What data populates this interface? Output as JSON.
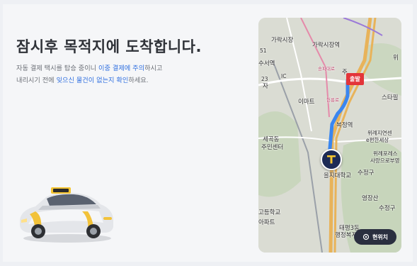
{
  "arrival": {
    "title": "잠시후 목적지에 도착합니다.",
    "line1_pre": "자동 결제 택시를 탑승 중이니 ",
    "line1_hl": "이중 결제에 주의",
    "line1_post": "하시고",
    "line2_pre": "내리시기 전에 ",
    "line2_hl": "잊으신 물건이 없는지 확인",
    "line2_post": "하세요."
  },
  "map": {
    "destination_label": "출발",
    "current_location_label": "현위치",
    "places": {
      "garak_market": "가락시장",
      "garak_market_station": "가락시장역",
      "suseo_station": "수서역",
      "lotte_mart": "이마트",
      "bokjeong_station": "복정역",
      "sejeong_center_1": "세곡동",
      "sejeong_center_2": "주민센터",
      "eulji_univ": "을지대학교",
      "sujeong_gu_1": "수정구",
      "sujeong_gu_2": "수정구",
      "yeongjangsan": "영장산",
      "taepyeong_1": "태평3동",
      "taepyeong_2": "행정복지",
      "high_school": "고등학교",
      "apartment": "아파트",
      "wirye_1": "위례지연센",
      "wirye_2": "e편한세상",
      "wirye_3": "위례포레스",
      "wirye_4": "사랑으로부영",
      "startown": "스타필",
      "wi": "위",
      "ja": "자",
      "ju": "주",
      "road_23": "23",
      "road_ic": "IC",
      "road_51": "51",
      "pink_1": "송파대로",
      "pink_2": "헌릉로"
    }
  },
  "colors": {
    "accent": "#2f6fe0",
    "route": "#3a86f0",
    "destination": "#e3353a",
    "taxi_pin": "#1d2a55"
  }
}
